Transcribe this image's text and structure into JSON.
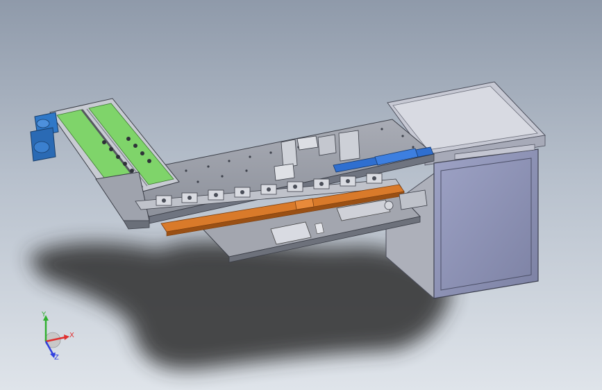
{
  "viewport": {
    "background_top": "#8f9aaa",
    "background_bottom": "#dfe4ea"
  },
  "model": {
    "frame_color": "#9a9ea8",
    "frame_dark": "#6f7480",
    "cabinet_color": "#8e93b4",
    "green_chute": "#7fd46a",
    "blue_motor": "#2f78c8",
    "orange_rail": "#d97a2a",
    "blue_bracket": "#2f6fd0"
  },
  "triad": {
    "x_label": "X",
    "y_label": "Y",
    "z_label": "Z",
    "x_color": "#e03030",
    "y_color": "#30b030",
    "z_color": "#3040e0"
  }
}
